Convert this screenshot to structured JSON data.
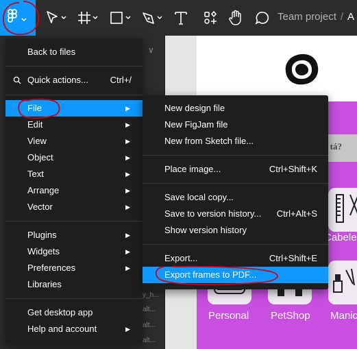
{
  "toolbar": {
    "project": "Team project",
    "separator": "/",
    "file_truncated": "A"
  },
  "left_panel": {
    "chevron": "∨",
    "rows": [
      "y_h...",
      "alt...",
      "alt...",
      "alt..."
    ]
  },
  "canvas": {
    "search_partial": "tá?",
    "categories": [
      {
        "label": "Personal"
      },
      {
        "label": "PetShop"
      },
      {
        "label": "Manic"
      },
      {
        "label": "Cabelei"
      }
    ],
    "colors": {
      "purple": "#c84fe0",
      "blue_accent": "#0d99ff",
      "annotation": "#d0021b"
    }
  },
  "menu": {
    "back": "Back to files",
    "quick_actions": "Quick actions...",
    "quick_actions_shortcut": "Ctrl+/",
    "items": [
      {
        "label": "File"
      },
      {
        "label": "Edit"
      },
      {
        "label": "View"
      },
      {
        "label": "Object"
      },
      {
        "label": "Text"
      },
      {
        "label": "Arrange"
      },
      {
        "label": "Vector"
      }
    ],
    "plugins": "Plugins",
    "widgets": "Widgets",
    "preferences": "Preferences",
    "libraries": "Libraries",
    "desktop_app": "Get desktop app",
    "help": "Help and account"
  },
  "submenu": {
    "new_design": "New design file",
    "new_figjam": "New FigJam file",
    "new_from_sketch": "New from Sketch file...",
    "place_image": "Place image...",
    "place_image_shortcut": "Ctrl+Shift+K",
    "save_local": "Save local copy...",
    "save_version": "Save to version history...",
    "save_version_shortcut": "Ctrl+Alt+S",
    "show_version": "Show version history",
    "export": "Export...",
    "export_shortcut": "Ctrl+Shift+E",
    "export_pdf": "Export frames to PDF..."
  }
}
